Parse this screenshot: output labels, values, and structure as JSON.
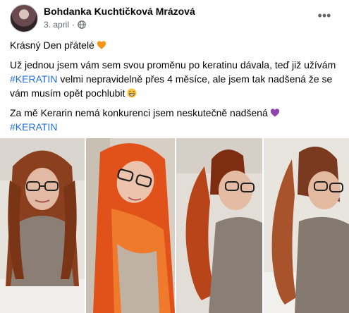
{
  "post": {
    "author": "Bohdanka Kuchtičková Mrázová",
    "date": "3. april",
    "separator": "·",
    "more_label": "•••",
    "icons": {
      "avatar": "profile-photo",
      "privacy": "globe-icon",
      "more": "more-options-icon"
    },
    "paragraphs": {
      "p1_text": "Krásný Den přátelé",
      "p1_emoji": "orange-heart-icon",
      "p2_text_a": "Už jednou jsem vám sem svou proměnu po keratinu dávala, teď již užívám ",
      "p2_hashtag": "#KERATIN",
      "p2_text_b": " velmi nepravidelně přes 4 měsíce, ale jsem tak nadšená že se vám musím opět pochlubit",
      "p2_emoji": "grinning-face-icon",
      "p3_text": "Za mě Kerarin nemá konkurenci jsem neskutečně nadšená",
      "p3_emoji": "purple-heart-icon",
      "p3_hashtag": "#KERATIN"
    },
    "colors": {
      "hashtag": "#216fdb",
      "secondary_text": "#65676b",
      "orange_heart": "#f7941d",
      "purple_heart": "#8e44ad"
    },
    "photos": [
      "photo-1",
      "photo-2",
      "photo-3",
      "photo-4"
    ]
  }
}
